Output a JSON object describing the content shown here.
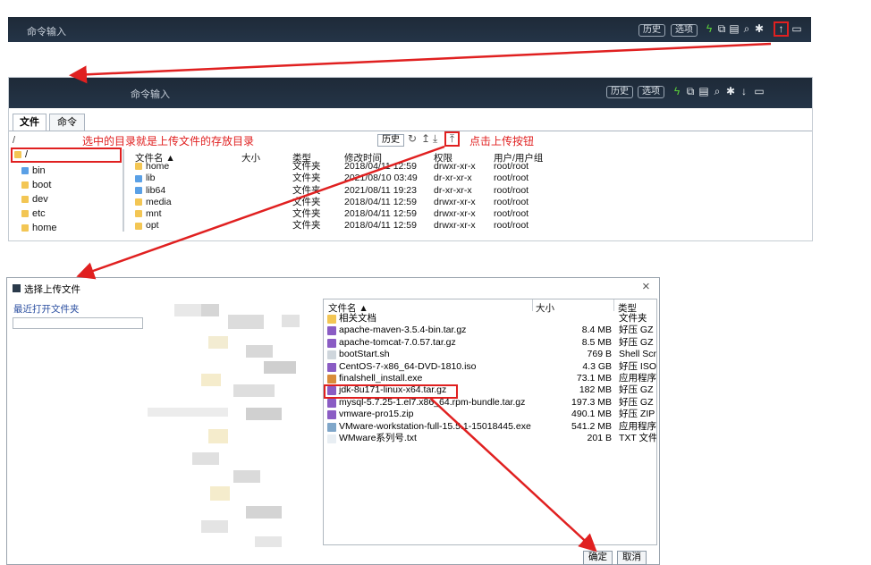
{
  "top_bar": {
    "cmd_input": "命令输入",
    "history": "历史",
    "options": "选项"
  },
  "main_bar": {
    "cmd_input": "命令输入",
    "history": "历史",
    "options": "选项"
  },
  "tabs": {
    "files": "文件",
    "commands": "命令"
  },
  "path": "/",
  "annotations": {
    "dir_note": "选中的目录就是上传文件的存放目录",
    "upload_note": "点击上传按钮"
  },
  "file_toolbar": {
    "history": "历史"
  },
  "tree": {
    "root": "/",
    "items": [
      "bin",
      "boot",
      "dev",
      "etc",
      "home"
    ]
  },
  "file_table": {
    "headers": {
      "name": "文件名 ▲",
      "size": "大小",
      "type": "类型",
      "modified": "修改时间",
      "perm": "权限",
      "owner": "用户/用户组"
    },
    "rows": [
      {
        "name": "home",
        "type": "文件夹",
        "modified": "2018/04/11 12:59",
        "perm": "drwxr-xr-x",
        "owner": "root/root"
      },
      {
        "name": "lib",
        "type": "文件夹",
        "modified": "2021/08/10 03:49",
        "perm": "dr-xr-xr-x",
        "owner": "root/root"
      },
      {
        "name": "lib64",
        "type": "文件夹",
        "modified": "2021/08/11 19:23",
        "perm": "dr-xr-xr-x",
        "owner": "root/root"
      },
      {
        "name": "media",
        "type": "文件夹",
        "modified": "2018/04/11 12:59",
        "perm": "drwxr-xr-x",
        "owner": "root/root"
      },
      {
        "name": "mnt",
        "type": "文件夹",
        "modified": "2018/04/11 12:59",
        "perm": "drwxr-xr-x",
        "owner": "root/root"
      },
      {
        "name": "opt",
        "type": "文件夹",
        "modified": "2018/04/11 12:59",
        "perm": "drwxr-xr-x",
        "owner": "root/root"
      }
    ]
  },
  "upload_dialog": {
    "title": "选择上传文件",
    "recent": "最近打开文件夹",
    "headers": {
      "name": "文件名 ▲",
      "size": "大小",
      "type": "类型"
    },
    "files": [
      {
        "name": "相关文档",
        "size": "",
        "type": "文件夹",
        "color": "#f3c654"
      },
      {
        "name": "apache-maven-3.5.4-bin.tar.gz",
        "size": "8.4 MB",
        "type": "好压 GZ .",
        "color": "#8a5cc4"
      },
      {
        "name": "apache-tomcat-7.0.57.tar.gz",
        "size": "8.5 MB",
        "type": "好压 GZ .",
        "color": "#8a5cc4"
      },
      {
        "name": "bootStart.sh",
        "size": "769 B",
        "type": "Shell Scri",
        "color": "#cfd6dc"
      },
      {
        "name": "CentOS-7-x86_64-DVD-1810.iso",
        "size": "4.3 GB",
        "type": "好压 ISO",
        "color": "#8a5cc4"
      },
      {
        "name": "finalshell_install.exe",
        "size": "73.1 MB",
        "type": "应用程序",
        "color": "#d98c3a"
      },
      {
        "name": "jdk-8u171-linux-x64.tar.gz",
        "size": "182 MB",
        "type": "好压 GZ .",
        "color": "#8a5cc4"
      },
      {
        "name": "mysql-5.7.25-1.el7.x86_64.rpm-bundle.tar.gz",
        "size": "197.3 MB",
        "type": "好压 GZ .",
        "color": "#8a5cc4"
      },
      {
        "name": "vmware-pro15.zip",
        "size": "490.1 MB",
        "type": "好压 ZIP",
        "color": "#8a5cc4"
      },
      {
        "name": "VMware-workstation-full-15.5.1-15018445.exe",
        "size": "541.2 MB",
        "type": "应用程序",
        "color": "#7fa6c9"
      },
      {
        "name": "WMware系列号.txt",
        "size": "201 B",
        "type": "TXT 文件",
        "color": "#e8eef3"
      }
    ],
    "ok": "确定",
    "cancel": "取消",
    "close": "×"
  }
}
